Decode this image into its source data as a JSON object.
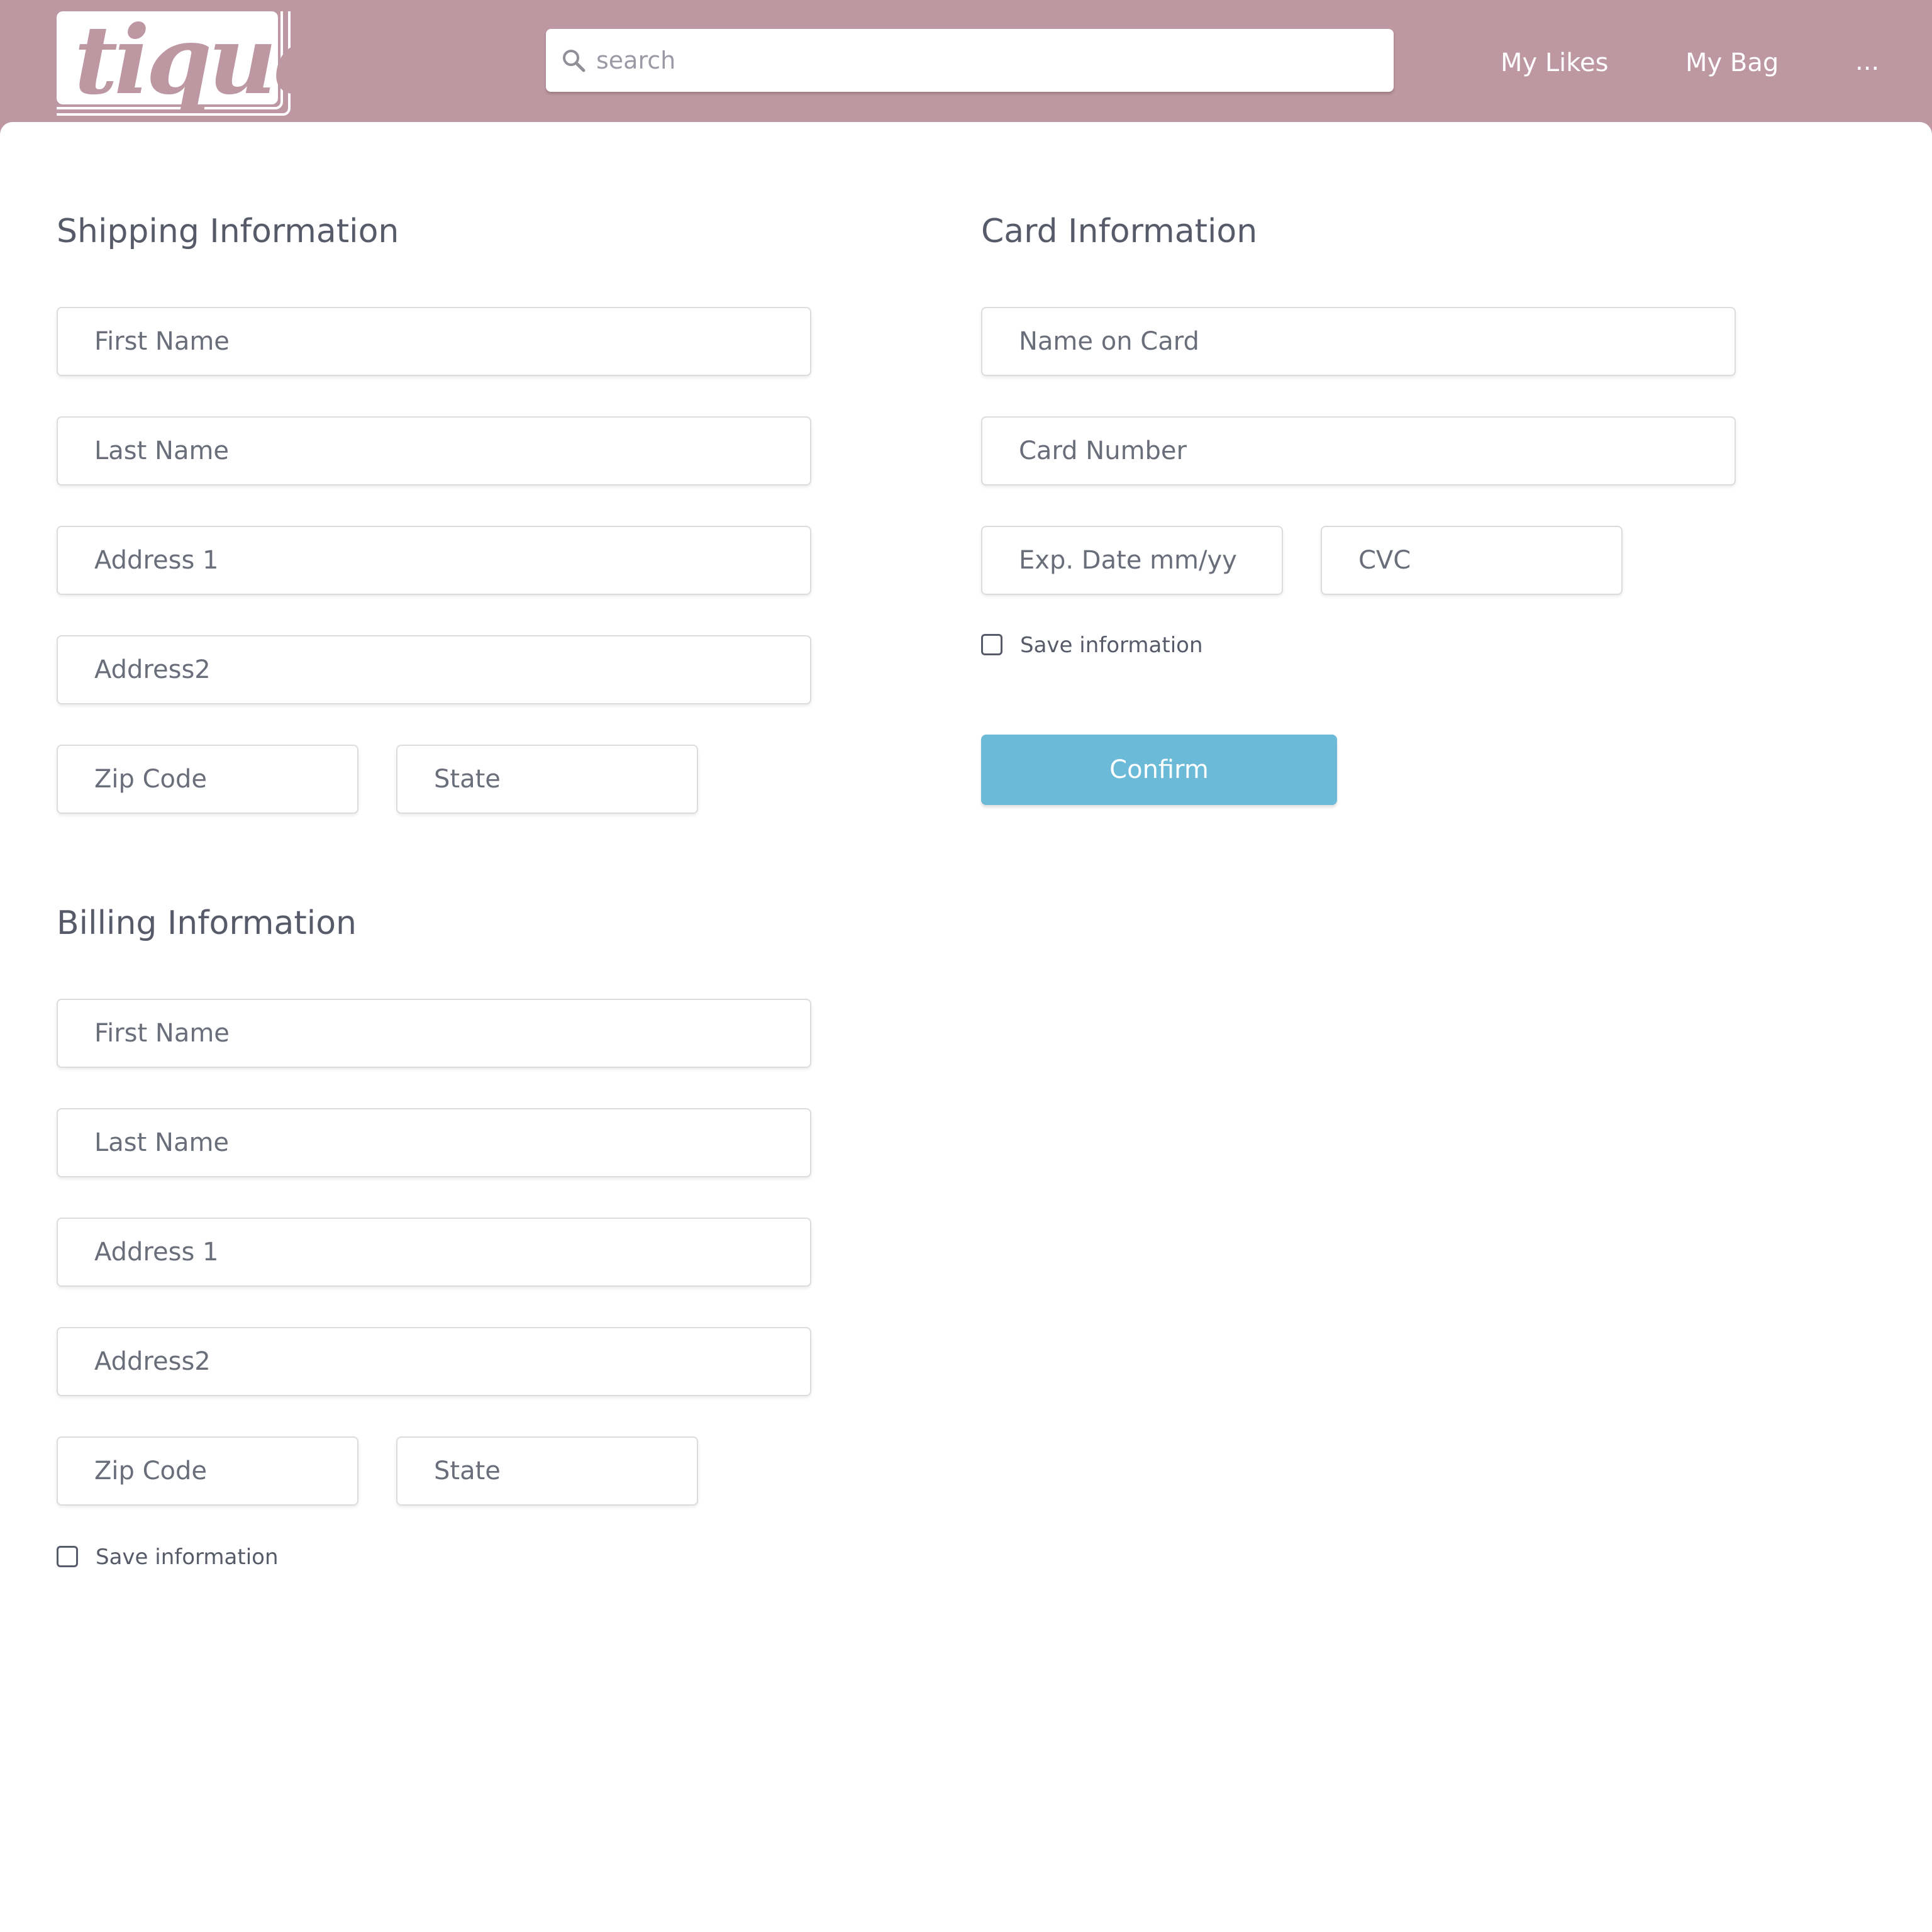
{
  "brand": {
    "logo_text": "tique",
    "color": "#bd97a1"
  },
  "search": {
    "placeholder": "search",
    "icon": "search-icon"
  },
  "nav": {
    "likes_label": "My Likes",
    "bag_label": "My Bag",
    "more_label": "..."
  },
  "shipping": {
    "title": "Shipping Information",
    "first_name_placeholder": "First Name",
    "last_name_placeholder": "Last Name",
    "address1_placeholder": "Address 1",
    "address2_placeholder": "Address2",
    "zip_placeholder": "Zip Code",
    "state_placeholder": "State"
  },
  "billing": {
    "title": "Billing Information",
    "first_name_placeholder": "First Name",
    "last_name_placeholder": "Last Name",
    "address1_placeholder": "Address 1",
    "address2_placeholder": "Address2",
    "zip_placeholder": "Zip Code",
    "state_placeholder": "State",
    "save_label": "Save information",
    "save_checked": false
  },
  "card": {
    "title": "Card Information",
    "name_placeholder": "Name on Card",
    "number_placeholder": "Card Number",
    "exp_placeholder": "Exp. Date mm/yy",
    "cvc_placeholder": "CVC",
    "save_label": "Save information",
    "save_checked": false
  },
  "actions": {
    "confirm_label": "Confirm",
    "confirm_color": "#6bbad7"
  }
}
